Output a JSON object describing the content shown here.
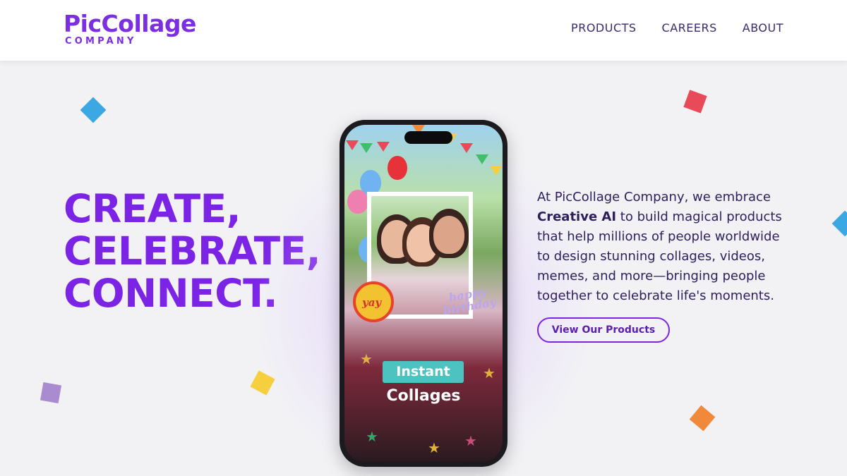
{
  "header": {
    "logo_main": "PicCollage",
    "logo_sub": "COMPANY",
    "nav": [
      "PRODUCTS",
      "CAREERS",
      "ABOUT"
    ]
  },
  "hero": {
    "headline": [
      "CREATE,",
      "CELEBRATE,",
      "CONNECT."
    ],
    "description_before": "At PicCollage Company, we embrace ",
    "description_bold": "Creative AI",
    "description_after": " to build magical products that help millions of people worldwide to design stunning collages, videos, memes, and more—bringing people together to celebrate life's moments.",
    "cta": "View Our Products"
  },
  "phone": {
    "sticker_yay": "yay",
    "sticker_birthday_1": "happy",
    "sticker_birthday_2": "birthday",
    "tag_line_1": "Instant",
    "tag_line_2": "Collages"
  },
  "colors": {
    "brand_purple": "#7b24e6",
    "confetti": [
      "#3ba7e3",
      "#e94a5a",
      "#a98cd0",
      "#f5cf3d",
      "#f08a3a"
    ]
  }
}
